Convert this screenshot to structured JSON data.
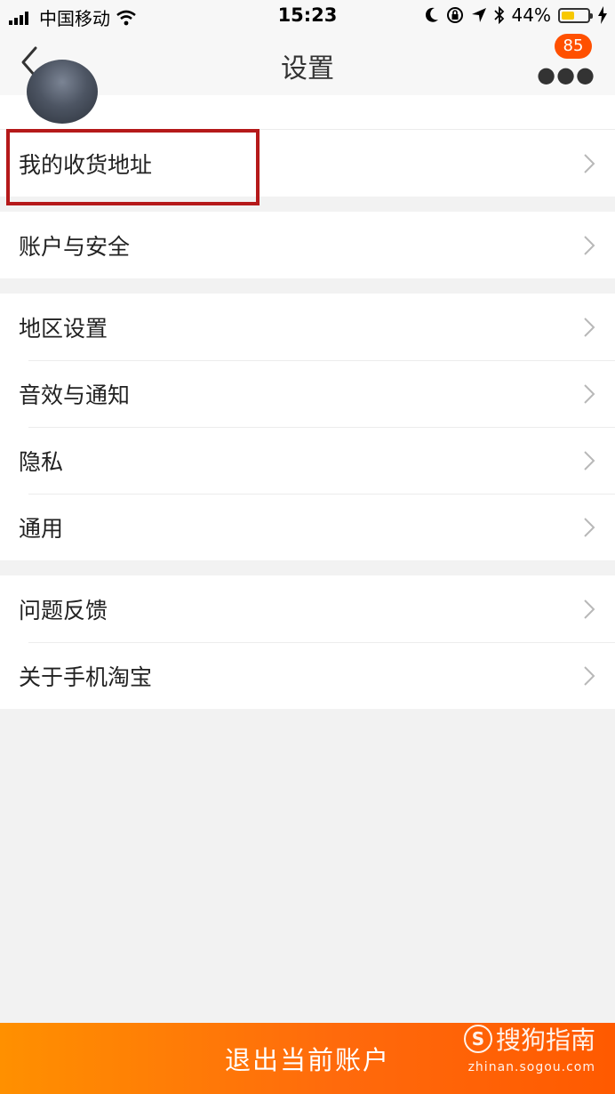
{
  "status_bar": {
    "carrier": "中国移动",
    "time": "15:23",
    "battery_percent": "44%",
    "icons": [
      "signal-icon",
      "wifi-icon",
      "moon-icon",
      "rotation-lock-icon",
      "location-icon",
      "bluetooth-icon",
      "battery-icon",
      "charging-icon"
    ]
  },
  "nav": {
    "title": "设置",
    "back_icon": "chevron-left-icon",
    "more_icon": "more-dots-icon",
    "badge_count": "85"
  },
  "groups": [
    {
      "items": [
        {
          "label": "我的收货地址",
          "highlighted": true
        }
      ]
    },
    {
      "items": [
        {
          "label": "账户与安全"
        }
      ]
    },
    {
      "items": [
        {
          "label": "地区设置"
        },
        {
          "label": "音效与通知"
        },
        {
          "label": "隐私"
        },
        {
          "label": "通用"
        }
      ]
    },
    {
      "items": [
        {
          "label": "问题反馈"
        },
        {
          "label": "关于手机淘宝"
        }
      ]
    }
  ],
  "logout_label": "退出当前账户",
  "watermark": {
    "brand": "搜狗指南",
    "url": "zhinan.sogou.com"
  },
  "colors": {
    "accent": "#ff5000",
    "highlight_border": "#b5191a",
    "battery_fill": "#f7c800"
  }
}
